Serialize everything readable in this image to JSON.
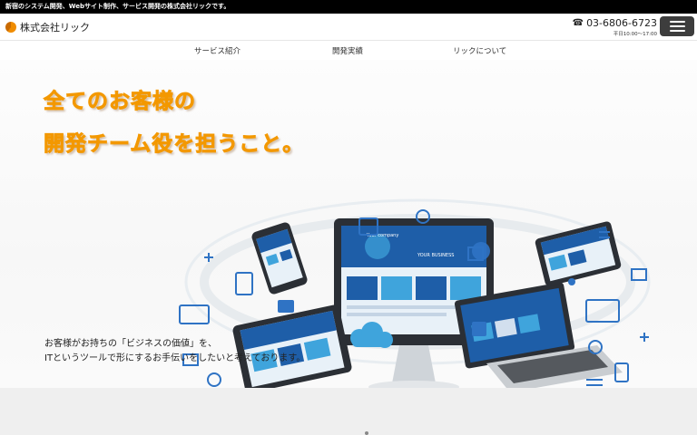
{
  "topbar": {
    "text": "新宿のシステム開発、Webサイト制作、サービス開発の株式会社リックです。"
  },
  "header": {
    "logo_text": "株式会社リック",
    "phone": "03-6806-6723",
    "hours": "平日10:00〜17:00",
    "menu_icon": "hamburger-icon"
  },
  "nav": {
    "items": [
      {
        "label": "サービス紹介"
      },
      {
        "label": "開発実績"
      },
      {
        "label": "リックについて"
      }
    ]
  },
  "hero": {
    "headline_1": "全てのお客様の",
    "headline_2": "開発チーム役を担うこと。",
    "body_1": "お客様がお持ちの「ビジネスの価値」を、",
    "body_2": "ITというツールで形にするお手伝いをしたいと考えております。",
    "screen_text_1": "Your company",
    "screen_text_2": "YOUR BUSINESS"
  },
  "colors": {
    "accent": "#f39800",
    "brand_blue": "#1e5ea8",
    "light_blue": "#3fa4dc"
  }
}
